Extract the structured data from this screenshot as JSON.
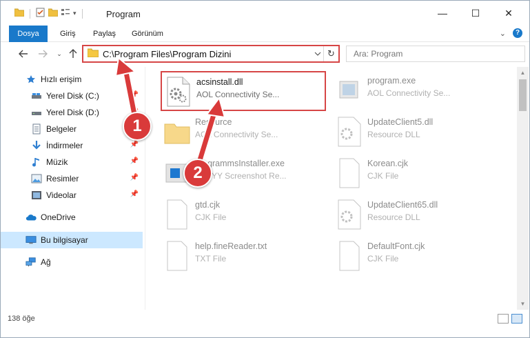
{
  "window": {
    "title": "Program",
    "minimize_glyph": "—",
    "maximize_glyph": "☐",
    "close_glyph": "✕"
  },
  "ribbon": {
    "tabs": [
      "Dosya",
      "Giriş",
      "Paylaş",
      "Görünüm"
    ],
    "accent": "#1979ca",
    "collapse_glyph": "⌄",
    "help_label": "?"
  },
  "address": {
    "path": "C:\\Program Files\\Program Dizini",
    "refresh_glyph": "↻"
  },
  "search": {
    "placeholder": "Ara: Program"
  },
  "nav": {
    "items": [
      {
        "label": "Hızlı erişim",
        "icon": "star-icon",
        "pinned": false
      },
      {
        "label": "Yerel Disk (C:)",
        "icon": "drive-icon",
        "pinned": true
      },
      {
        "label": "Yerel Disk (D:)",
        "icon": "drive-icon",
        "pinned": true
      },
      {
        "label": "Belgeler",
        "icon": "documents-icon",
        "pinned": true
      },
      {
        "label": "İndirmeler",
        "icon": "downloads-icon",
        "pinned": true
      },
      {
        "label": "Müzik",
        "icon": "music-icon",
        "pinned": true
      },
      {
        "label": "Resimler",
        "icon": "pictures-icon",
        "pinned": true
      },
      {
        "label": "Videolar",
        "icon": "videos-icon",
        "pinned": true
      },
      {
        "label": "OneDrive",
        "icon": "cloud-icon",
        "pinned": false
      },
      {
        "label": "Bu bilgisayar",
        "icon": "computer-icon",
        "pinned": false,
        "selected": true
      },
      {
        "label": "Ağ",
        "icon": "network-icon",
        "pinned": false
      }
    ]
  },
  "files": [
    {
      "name": "acsinstall.dll",
      "desc": "AOL Connectivity Se...",
      "icon": "dll-icon",
      "highlighted": true
    },
    {
      "name": "program.exe",
      "desc": "AOL Connectivity Se...",
      "icon": "exe-icon"
    },
    {
      "name": "Resource",
      "desc": "AOL Connectivity Se...",
      "icon": "folder-icon"
    },
    {
      "name": "UpdateClient5.dll",
      "desc": "Resource DLL",
      "icon": "dll-icon"
    },
    {
      "name": "programmsInstaller.exe",
      "desc": "ABBYY Screenshot Re...",
      "icon": "installer-icon"
    },
    {
      "name": "Korean.cjk",
      "desc": "CJK File",
      "icon": "file-icon"
    },
    {
      "name": "gtd.cjk",
      "desc": "CJK File",
      "icon": "file-icon"
    },
    {
      "name": "UpdateClient65.dll",
      "desc": "Resource DLL",
      "icon": "dll-icon"
    },
    {
      "name": "help.fineReader.txt",
      "desc": "TXT File",
      "icon": "file-icon"
    },
    {
      "name": "DefaultFont.cjk",
      "desc": "CJK File",
      "icon": "file-icon"
    }
  ],
  "status": {
    "count": "138 öğe"
  },
  "annotations": {
    "badge1": "1",
    "badge2": "2",
    "color": "#d93a3a"
  }
}
